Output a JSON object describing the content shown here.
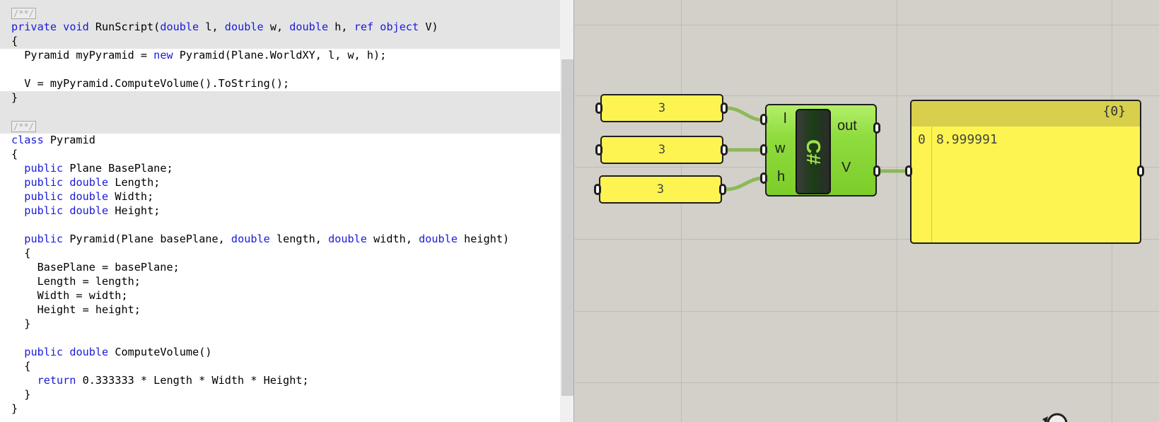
{
  "editor": {
    "lines": [
      {
        "type": "fold",
        "fold": "/**/"
      },
      {
        "type": "code",
        "tokens": [
          {
            "t": "private",
            "k": true
          },
          {
            "t": " "
          },
          {
            "t": "void",
            "k": true
          },
          {
            "t": " RunScript("
          },
          {
            "t": "double",
            "k": true
          },
          {
            "t": " l, "
          },
          {
            "t": "double",
            "k": true
          },
          {
            "t": " w, "
          },
          {
            "t": "double",
            "k": true
          },
          {
            "t": " h, "
          },
          {
            "t": "ref",
            "k": true
          },
          {
            "t": " "
          },
          {
            "t": "object",
            "k": true
          },
          {
            "t": " V)"
          }
        ]
      },
      {
        "type": "code",
        "tokens": [
          {
            "t": "{"
          }
        ]
      },
      {
        "type": "code",
        "tokens": [
          {
            "t": "  Pyramid myPyramid = "
          },
          {
            "t": "new",
            "k": true
          },
          {
            "t": " Pyramid(Plane.WorldXY, l, w, h);"
          }
        ]
      },
      {
        "type": "code",
        "tokens": []
      },
      {
        "type": "code",
        "tokens": [
          {
            "t": "  V = myPyramid.ComputeVolume().ToString();"
          }
        ]
      },
      {
        "type": "code",
        "tokens": [
          {
            "t": "}"
          }
        ]
      },
      {
        "type": "code",
        "tokens": []
      },
      {
        "type": "fold",
        "fold": "/**/"
      },
      {
        "type": "code",
        "tokens": [
          {
            "t": "class",
            "k": true
          },
          {
            "t": " Pyramid"
          }
        ]
      },
      {
        "type": "code",
        "tokens": [
          {
            "t": "{"
          }
        ]
      },
      {
        "type": "code",
        "tokens": [
          {
            "t": "  "
          },
          {
            "t": "public",
            "k": true
          },
          {
            "t": " Plane BasePlane;"
          }
        ]
      },
      {
        "type": "code",
        "tokens": [
          {
            "t": "  "
          },
          {
            "t": "public",
            "k": true
          },
          {
            "t": " "
          },
          {
            "t": "double",
            "k": true
          },
          {
            "t": " Length;"
          }
        ]
      },
      {
        "type": "code",
        "tokens": [
          {
            "t": "  "
          },
          {
            "t": "public",
            "k": true
          },
          {
            "t": " "
          },
          {
            "t": "double",
            "k": true
          },
          {
            "t": " Width;"
          }
        ]
      },
      {
        "type": "code",
        "tokens": [
          {
            "t": "  "
          },
          {
            "t": "public",
            "k": true
          },
          {
            "t": " "
          },
          {
            "t": "double",
            "k": true
          },
          {
            "t": " Height;"
          }
        ]
      },
      {
        "type": "code",
        "tokens": []
      },
      {
        "type": "code",
        "tokens": [
          {
            "t": "  "
          },
          {
            "t": "public",
            "k": true
          },
          {
            "t": " Pyramid(Plane basePlane, "
          },
          {
            "t": "double",
            "k": true
          },
          {
            "t": " length, "
          },
          {
            "t": "double",
            "k": true
          },
          {
            "t": " width, "
          },
          {
            "t": "double",
            "k": true
          },
          {
            "t": " height)"
          }
        ]
      },
      {
        "type": "code",
        "tokens": [
          {
            "t": "  {"
          }
        ]
      },
      {
        "type": "code",
        "tokens": [
          {
            "t": "    BasePlane = basePlane;"
          }
        ]
      },
      {
        "type": "code",
        "tokens": [
          {
            "t": "    Length = length;"
          }
        ]
      },
      {
        "type": "code",
        "tokens": [
          {
            "t": "    Width = width;"
          }
        ]
      },
      {
        "type": "code",
        "tokens": [
          {
            "t": "    Height = height;"
          }
        ]
      },
      {
        "type": "code",
        "tokens": [
          {
            "t": "  }"
          }
        ]
      },
      {
        "type": "code",
        "tokens": []
      },
      {
        "type": "code",
        "tokens": [
          {
            "t": "  "
          },
          {
            "t": "public",
            "k": true
          },
          {
            "t": " "
          },
          {
            "t": "double",
            "k": true
          },
          {
            "t": " ComputeVolume()"
          }
        ]
      },
      {
        "type": "code",
        "tokens": [
          {
            "t": "  {"
          }
        ]
      },
      {
        "type": "code",
        "tokens": [
          {
            "t": "    "
          },
          {
            "t": "return",
            "k": true
          },
          {
            "t": " 0.333333 * Length * Width * Height;"
          }
        ]
      },
      {
        "type": "code",
        "tokens": [
          {
            "t": "  }"
          }
        ]
      },
      {
        "type": "code",
        "tokens": [
          {
            "t": "}"
          }
        ]
      }
    ]
  },
  "canvas": {
    "sliders": [
      {
        "id": "l",
        "value": "3"
      },
      {
        "id": "w",
        "value": "3"
      },
      {
        "id": "h",
        "value": "3"
      }
    ],
    "component": {
      "badge": "C#",
      "inputs": [
        "l",
        "w",
        "h"
      ],
      "outputs": [
        "out",
        "V"
      ]
    },
    "panel": {
      "path": "{0}",
      "index": "0",
      "value": "8.999991"
    }
  },
  "colors": {
    "keyword": "#1a1adb",
    "panel_yellow": "#fdf451",
    "component_green": "#8fdc3e",
    "wire_green": "#8eb85a"
  }
}
